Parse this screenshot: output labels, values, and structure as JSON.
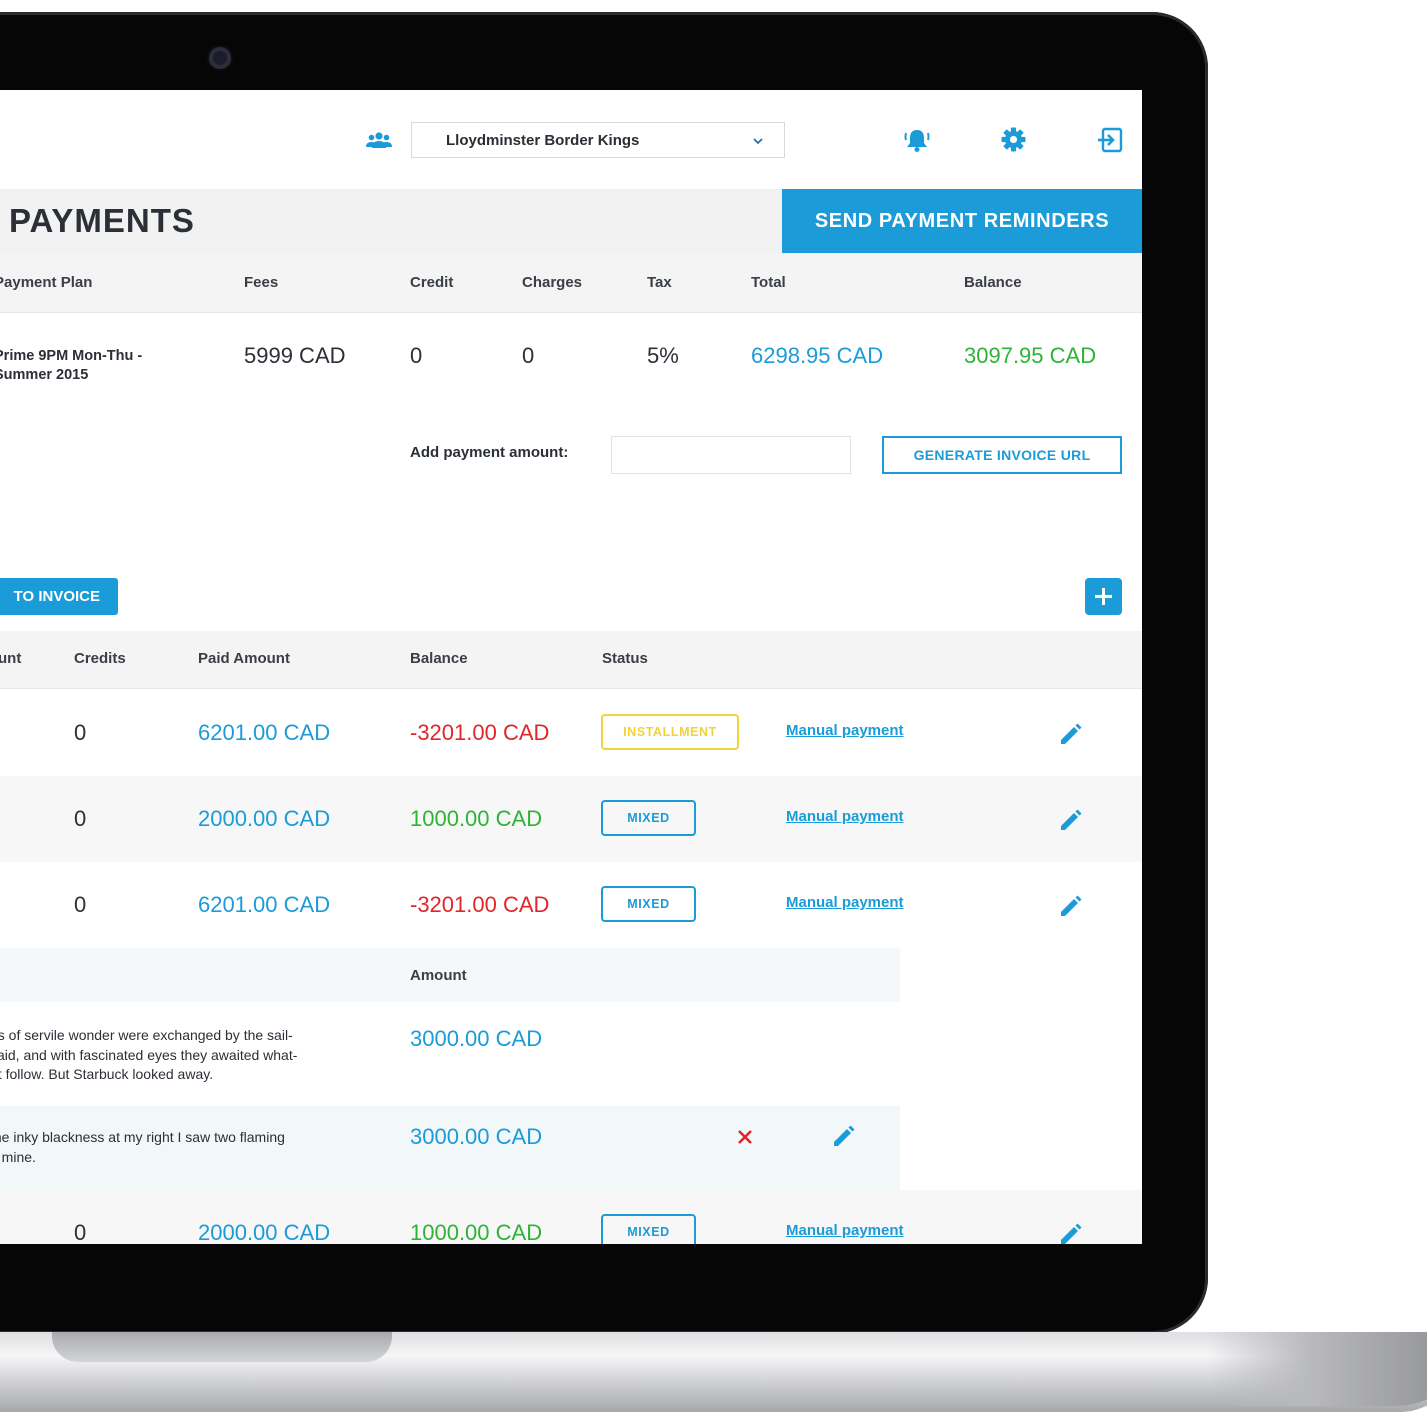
{
  "header": {
    "team_select_value": "Lloydminster Border Kings",
    "icons": [
      "team-icon",
      "chevron-down-icon",
      "bell-icon",
      "gear-icon",
      "logout-icon"
    ]
  },
  "page": {
    "title": "PAYMENTS",
    "send_reminders_label": "SEND PAYMENT REMINDERS"
  },
  "plan_table": {
    "headers": [
      "Payment Plan",
      "Fees",
      "Credit",
      "Charges",
      "Tax",
      "Total",
      "Balance"
    ],
    "row": {
      "plan_line1": "Prime 9PM Mon-Thu -",
      "plan_line2": "Summer 2015",
      "fees": "5999 CAD",
      "credit": "0",
      "charges": "0",
      "tax": "5%",
      "total": "6298.95 CAD",
      "balance": "3097.95 CAD"
    }
  },
  "payment": {
    "add_amount_label": "Add payment amount:",
    "amount_value": "",
    "generate_button": "GENERATE INVOICE URL"
  },
  "invoices": {
    "add_to_invoice_button": "TO INVOICE",
    "headers": [
      "Amount",
      "Credits",
      "Paid Amount",
      "Balance",
      "Status"
    ],
    "header_amount_visible": "unt",
    "manual_payment_label": "Manual payment",
    "rows": [
      {
        "credits": "0",
        "paid": "6201.00 CAD",
        "balance": "-3201.00 CAD",
        "status": "INSTALLMENT"
      },
      {
        "credits": "0",
        "paid": "2000.00 CAD",
        "balance": "1000.00 CAD",
        "status": "MIXED"
      },
      {
        "credits": "0",
        "paid": "6201.00 CAD",
        "balance": "-3201.00 CAD",
        "status": "MIXED"
      },
      {
        "credits": "0",
        "paid": "2000.00 CAD",
        "balance": "1000.00 CAD",
        "status": "MIXED"
      }
    ],
    "sub_table": {
      "amount_header": "Amount",
      "items": [
        {
          "desc_line1": "es of servile wonder were exchanged by the sail-",
          "desc_line2": "said, and with fascinated eyes they awaited what-",
          "desc_line3": "ht follow. But Starbuck looked away.",
          "amount": "3000.00 CAD"
        },
        {
          "desc_line1": "the inky blackness at my right I saw two flaming",
          "desc_line2": "o mine.",
          "amount": "3000.00 CAD"
        }
      ]
    }
  },
  "colors": {
    "accent_blue": "#1b9bd8",
    "positive_green": "#2fb336",
    "negative_red": "#e0262b",
    "installment_yellow": "#f1d23a"
  }
}
